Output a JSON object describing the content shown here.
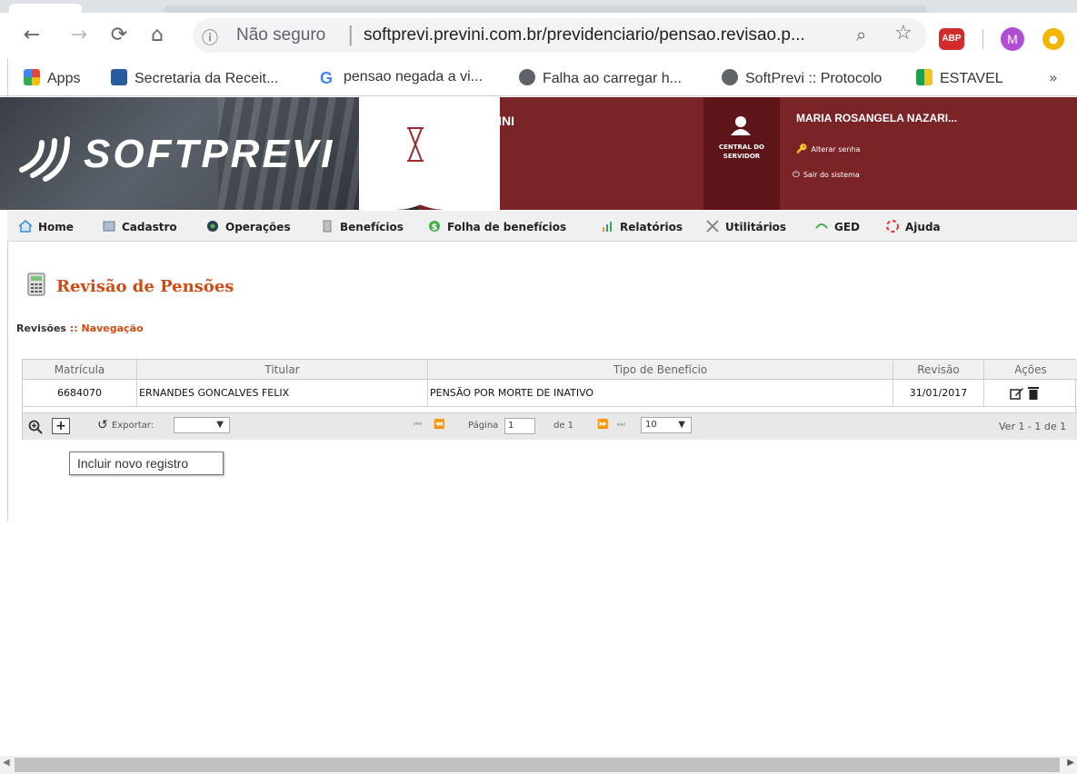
{
  "browser": {
    "not_secure_label": "Não seguro",
    "url": "softprevi.previni.com.br/previdenciario/pensao.revisao.p...",
    "extension_abp": "ABP",
    "profile_initial": "M",
    "bookmarks": [
      "Apps",
      "Secretaria da Receit...",
      "pensao negada a vi...",
      "Falha ao carregar h...",
      "SoftPrevi :: Protocolo",
      "ESTAVEL"
    ],
    "bookmarks_more": "»"
  },
  "header": {
    "logo_text": "SOFTPREVI",
    "org_name": "PREVINI",
    "central_label": "CENTRAL DO SERVIDOR",
    "user_name": "MARIA ROSANGELA NAZARI...",
    "change_password": "Alterar senha",
    "logout": "Sair do sistema"
  },
  "menu": [
    "Home",
    "Cadastro",
    "Operações",
    "Benefícios",
    "Folha de benefícios",
    "Relatórios",
    "Utilitários",
    "GED",
    "Ajuda"
  ],
  "page": {
    "title": "Revisão de Pensões",
    "breadcrumb_a": "Revisões",
    "breadcrumb_sep": " :: ",
    "breadcrumb_b": "Navegação"
  },
  "grid": {
    "columns": [
      "Matrícula",
      "Titular",
      "Tipo de Benefício",
      "Revisão",
      "Ações"
    ],
    "rows": [
      {
        "matricula": "6684070",
        "titular": "ERNANDES GONCALVES FELIX",
        "tipo": "PENSÃO POR MORTE DE INATIVO",
        "revisao": "31/01/2017"
      }
    ],
    "export_label": "Exportar:",
    "page_label": "Página",
    "page_value": "1",
    "page_of": "de 1",
    "page_size": "10",
    "records": "Ver 1 - 1 de 1"
  },
  "tooltip": "Incluir novo registro",
  "colors": {
    "header_red": "#7a2428",
    "title_orange": "#d24a12"
  }
}
